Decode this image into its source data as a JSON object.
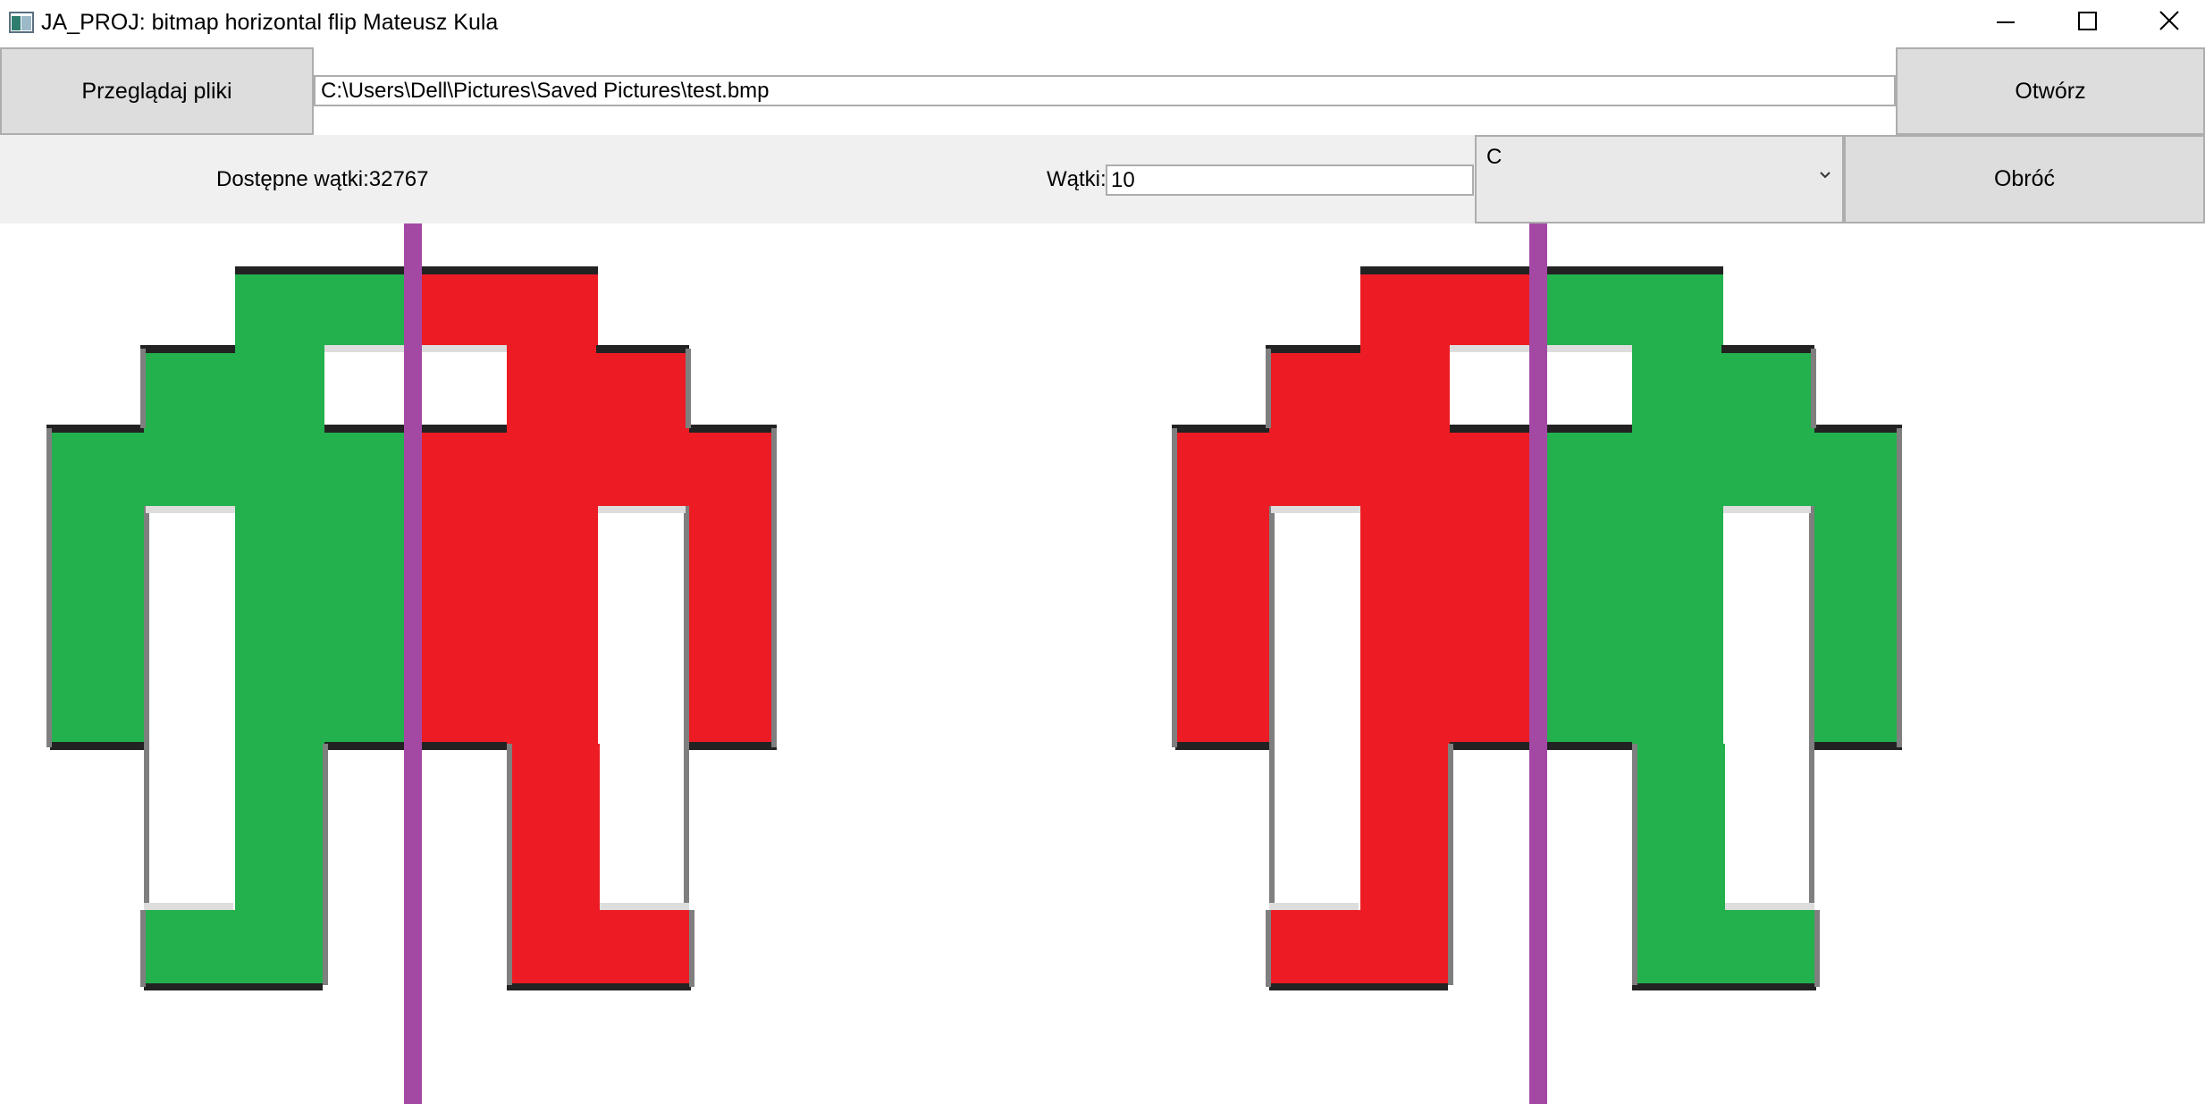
{
  "window": {
    "title": "JA_PROJ: bitmap horizontal flip Mateusz Kula",
    "icon": "app-window-icon",
    "controls": [
      "minimize-icon",
      "maximize-icon",
      "close-icon"
    ]
  },
  "toolbar": {
    "browse_label": "Przeglądaj pliki",
    "file_path": "C:\\Users\\Dell\\Pictures\\Saved Pictures\\test.bmp",
    "open_label": "Otwórz"
  },
  "settings": {
    "available_threads": "Dostępne wątki:32767",
    "threads_label": "Wątki:",
    "threads_value": "10",
    "library_selected": "C",
    "flip_label": "Obróć"
  },
  "colors": {
    "green": "#22b14c",
    "red": "#ed1c24",
    "purple": "#a349a4",
    "dark_edge": "#222222",
    "gray_edge": "#7f7f7f",
    "light_edge": "#dddddd",
    "panel_bg": "#f0f0f0",
    "button_bg": "#dddddd"
  },
  "images": {
    "original": {
      "left_half": "green",
      "right_half": "red"
    },
    "flipped": {
      "left_half": "red",
      "right_half": "green"
    }
  }
}
